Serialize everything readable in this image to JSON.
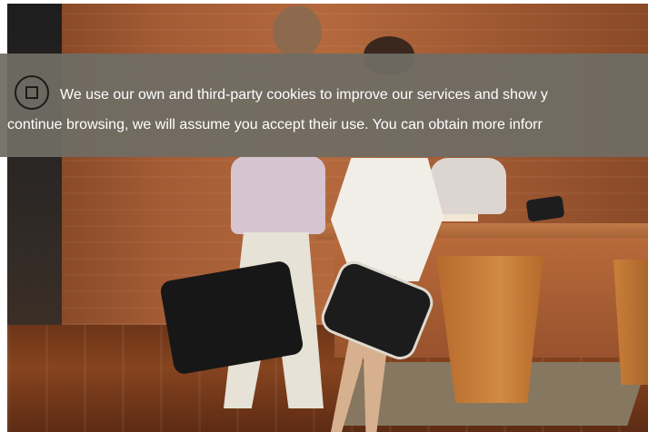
{
  "cookie_banner": {
    "line_1": "We use our own and third-party cookies to improve our services and show y",
    "line_2": "continue browsing, we will assume you accept their use. You can obtain more inforr",
    "accept_icon": "checkbox-icon"
  },
  "colors": {
    "banner_overlay": "#706C64",
    "text": "#FFFFFF",
    "button_border": "#1B1B1B"
  }
}
